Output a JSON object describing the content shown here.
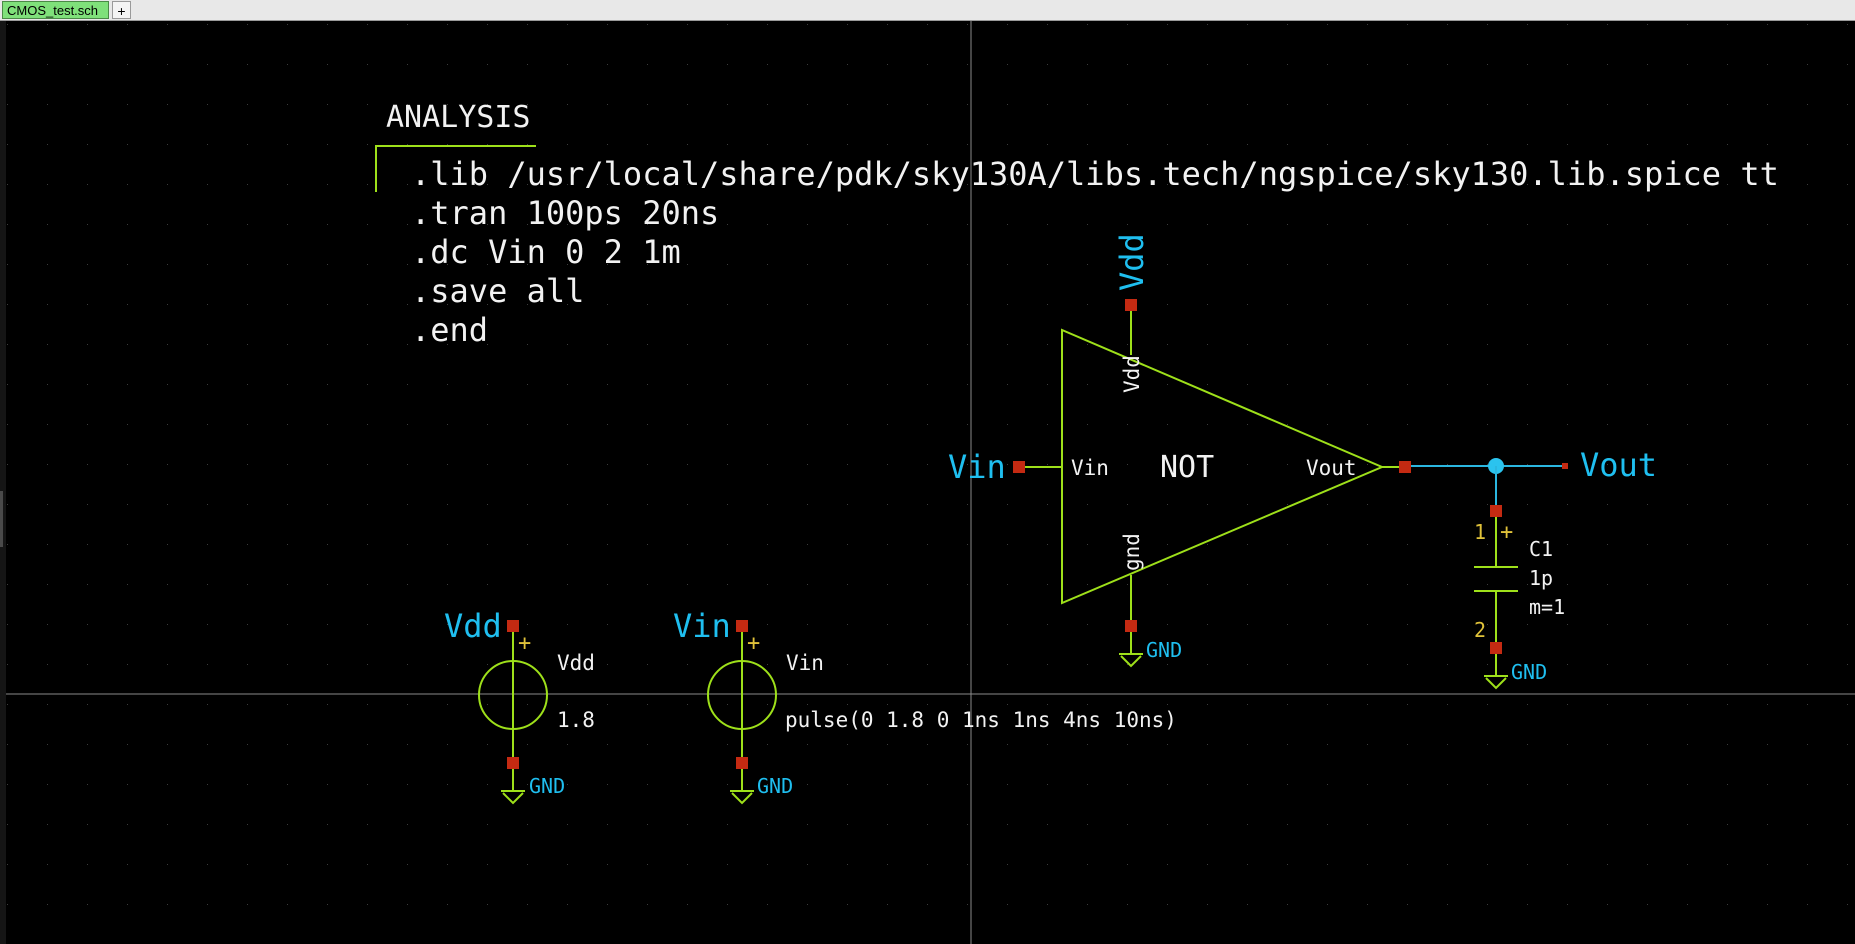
{
  "tabs": {
    "active_label": "CMOS_test.sch",
    "add_label": "+"
  },
  "colors": {
    "background": "#000000",
    "component": "#9ee01a",
    "wire": "#2bb7e0",
    "net_label": "#1fbff0",
    "pin": "#c42a12",
    "pin_number": "#e0c23a",
    "text": "#f2f2f2",
    "tab_active": "#7fe07a"
  },
  "analysis": {
    "title": "ANALYSIS",
    "lines": [
      ".lib /usr/local/share/pdk/sky130A/libs.tech/ngspice/sky130.lib.spice tt",
      ".tran 100ps 20ns",
      ".dc Vin 0 2 1m",
      ".save all",
      ".end"
    ]
  },
  "not_gate": {
    "name": "NOT",
    "pin_vdd": "Vdd",
    "pin_vin": "Vin",
    "pin_vout": "Vout",
    "pin_gnd": "gnd",
    "net_vdd": "Vdd",
    "net_vin": "Vin",
    "net_vout": "Vout",
    "net_gnd": "GND"
  },
  "capacitor": {
    "name": "C1",
    "value": "1p",
    "mult": "m=1",
    "pin1": "1",
    "pin2": "2",
    "plus": "+",
    "gnd": "GND"
  },
  "vdd_source": {
    "net": "Vdd",
    "name": "Vdd",
    "value": "1.8",
    "plus": "+",
    "gnd": "GND"
  },
  "vin_source": {
    "net": "Vin",
    "name": "Vin",
    "value": "pulse(0 1.8 0 1ns 1ns 4ns 10ns)",
    "plus": "+",
    "gnd": "GND"
  }
}
